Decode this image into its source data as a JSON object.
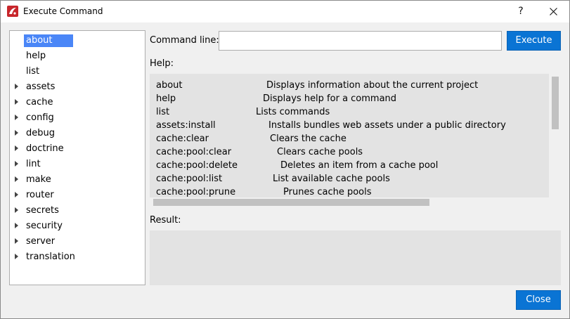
{
  "window": {
    "title": "Execute Command",
    "help_glyph": "?",
    "app_icon": "app-logo-icon",
    "close_icon": "close-icon"
  },
  "tree": {
    "items": [
      {
        "label": "about",
        "expandable": false,
        "selected": true
      },
      {
        "label": "help",
        "expandable": false,
        "selected": false
      },
      {
        "label": "list",
        "expandable": false,
        "selected": false
      },
      {
        "label": "assets",
        "expandable": true,
        "selected": false
      },
      {
        "label": "cache",
        "expandable": true,
        "selected": false
      },
      {
        "label": "config",
        "expandable": true,
        "selected": false
      },
      {
        "label": "debug",
        "expandable": true,
        "selected": false
      },
      {
        "label": "doctrine",
        "expandable": true,
        "selected": false
      },
      {
        "label": "lint",
        "expandable": true,
        "selected": false
      },
      {
        "label": "make",
        "expandable": true,
        "selected": false
      },
      {
        "label": "router",
        "expandable": true,
        "selected": false
      },
      {
        "label": "secrets",
        "expandable": true,
        "selected": false
      },
      {
        "label": "security",
        "expandable": true,
        "selected": false
      },
      {
        "label": "server",
        "expandable": true,
        "selected": false
      },
      {
        "label": "translation",
        "expandable": true,
        "selected": false
      }
    ]
  },
  "command": {
    "label": "Command line:",
    "value": "",
    "execute_label": "Execute"
  },
  "help": {
    "label": "Help:",
    "rows": [
      {
        "command": "about",
        "description": "Displays information about the current project"
      },
      {
        "command": "help",
        "description": "Displays help for a command"
      },
      {
        "command": "list",
        "description": "Lists commands"
      },
      {
        "command": "assets:install",
        "description": "Installs bundles web assets under a public directory"
      },
      {
        "command": "cache:clear",
        "description": "Clears the cache"
      },
      {
        "command": "cache:pool:clear",
        "description": "Clears cache pools"
      },
      {
        "command": "cache:pool:delete",
        "description": "Deletes an item from a cache pool"
      },
      {
        "command": "cache:pool:list",
        "description": "List available cache pools"
      },
      {
        "command": "cache:pool:prune",
        "description": "Prunes cache pools"
      }
    ]
  },
  "result": {
    "label": "Result:",
    "value": ""
  },
  "footer": {
    "close_label": "Close"
  },
  "colors": {
    "accent": "#0a74d4",
    "selection": "#4a86f7"
  }
}
